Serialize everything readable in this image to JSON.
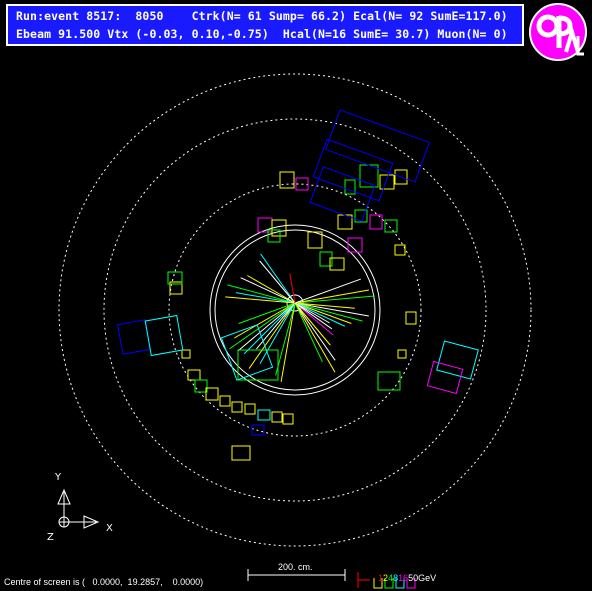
{
  "header": {
    "line1": "Run:event 8517:  8050    Ctrk(N= 61 Sump= 66.2) Ecal(N= 92 SumE=117.0)",
    "line2": "Ebeam 91.500 Vtx (-0.03, 0.10,-0.75)  Hcal(N=16 SumE= 30.7) Muon(N= 0)"
  },
  "axes": {
    "y": "Y",
    "x": "X",
    "z": "Z"
  },
  "scale": {
    "label": "200. cm."
  },
  "energy_scale": {
    "values": [
      "1",
      "2",
      "4",
      "8",
      "16",
      "50"
    ],
    "unit": "GeV",
    "colors": [
      "#ff0000",
      "#ffff00",
      "#00ff00",
      "#00ffff",
      "#ff00ff",
      "#ffffff"
    ]
  },
  "footer": {
    "text": "Centre of screen is (   0.0000,  19.2857,    0.0000)"
  },
  "colors": {
    "header_bg": "#1a1aff",
    "logo": "#ff00ff"
  }
}
